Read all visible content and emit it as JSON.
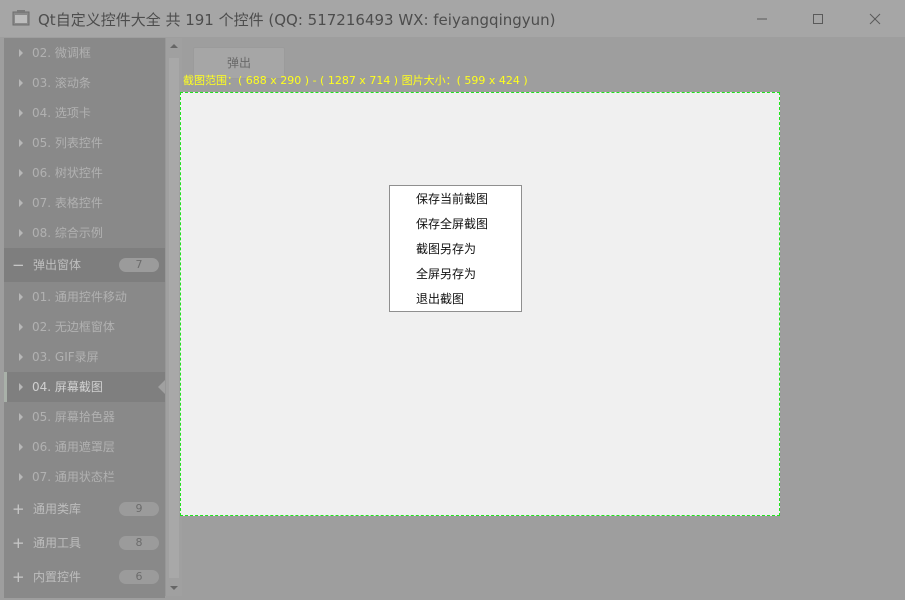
{
  "window": {
    "title": "Qt自定义控件大全 共 191 个控件 (QQ: 517216493 WX: feiyangqingyun)",
    "icons": {
      "minimize": "minimize-icon",
      "maximize": "maximize-icon",
      "close": "close-icon"
    }
  },
  "sidebar": {
    "top_items": [
      {
        "label": "02. 微调框"
      },
      {
        "label": "03. 滚动条"
      },
      {
        "label": "04. 选项卡"
      },
      {
        "label": "05. 列表控件"
      },
      {
        "label": "06. 树状控件"
      },
      {
        "label": "07. 表格控件"
      },
      {
        "label": "08. 综合示例"
      }
    ],
    "popup_group": {
      "label": "弹出窗体",
      "count": "7",
      "sign": "−"
    },
    "popup_items": [
      {
        "label": "01. 通用控件移动"
      },
      {
        "label": "02. 无边框窗体"
      },
      {
        "label": "03. GIF录屏"
      },
      {
        "label": "04. 屏幕截图"
      },
      {
        "label": "05. 屏幕拾色器"
      },
      {
        "label": "06. 通用遮罩层"
      },
      {
        "label": "07. 通用状态栏"
      }
    ],
    "groups": [
      {
        "label": "通用类库",
        "count": "9",
        "sign": "+"
      },
      {
        "label": "通用工具",
        "count": "8",
        "sign": "+"
      },
      {
        "label": "内置控件",
        "count": "6",
        "sign": "+"
      }
    ]
  },
  "main": {
    "popup_button": "弹出",
    "range_label": "截图范围：( 688 x 290 ) - ( 1287 x 714 )  图片大小：( 599 x 424 )"
  },
  "context_menu": {
    "items": [
      "保存当前截图",
      "保存全屏截图",
      "截图另存为",
      "全屏另存为",
      "退出截图"
    ]
  },
  "colors": {
    "selection_border": "#21e21e",
    "range_text": "#ffff1e",
    "overlay": "#9e9e9e"
  }
}
